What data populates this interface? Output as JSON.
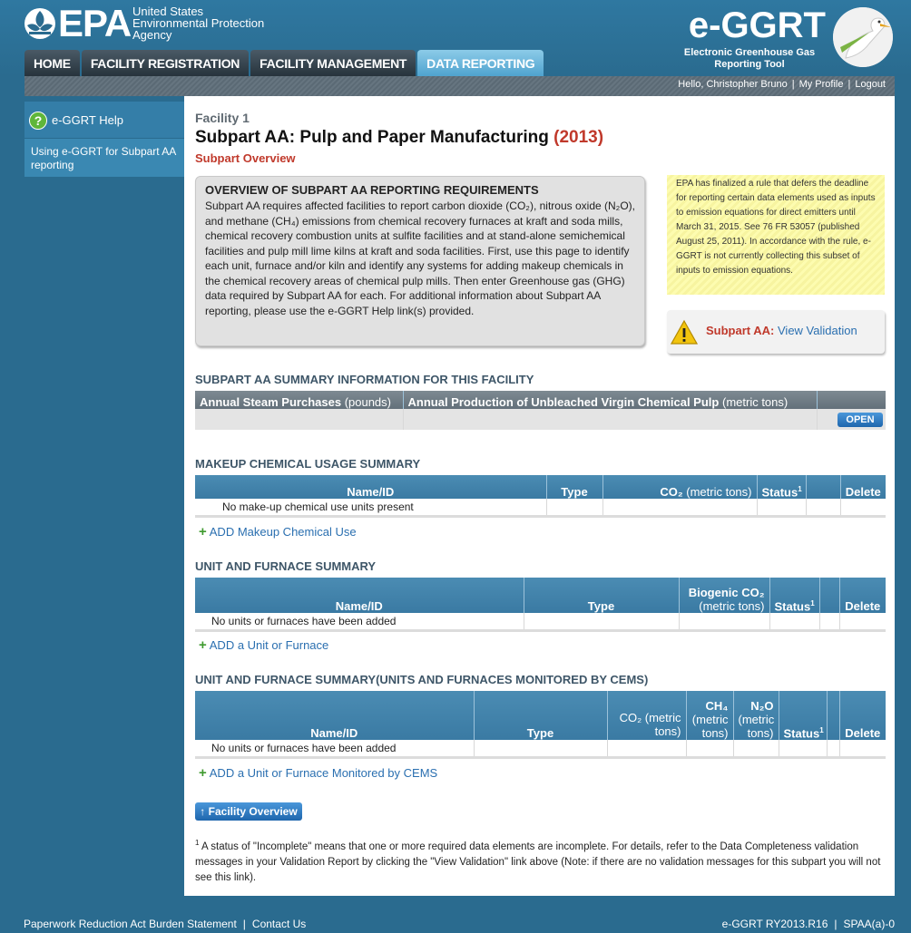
{
  "header": {
    "epa_word": "EPA",
    "agency": [
      "United States",
      "Environmental Protection",
      "Agency"
    ],
    "app_title": "e-GGRT",
    "app_subtitle": [
      "Electronic Greenhouse Gas",
      "Reporting Tool"
    ]
  },
  "nav": {
    "tabs": [
      {
        "label": "HOME"
      },
      {
        "label": "FACILITY REGISTRATION"
      },
      {
        "label": "FACILITY MANAGEMENT"
      },
      {
        "label": "DATA REPORTING",
        "active": true
      }
    ]
  },
  "userbar": {
    "greeting": "Hello, Christopher Bruno",
    "profile": "My Profile",
    "logout": "Logout"
  },
  "sidebar": {
    "help_label": "e-GGRT Help",
    "help_item": "Using e-GGRT for Subpart AA reporting"
  },
  "page": {
    "facility": "Facility 1",
    "title": "Subpart AA: Pulp and Paper Manufacturing",
    "year": "(2013)",
    "subtitle": "Subpart Overview"
  },
  "overview": {
    "heading": "OVERVIEW OF SUBPART AA REPORTING REQUIREMENTS",
    "text": "Subpart AA requires affected facilities to report carbon dioxide (CO₂), nitrous oxide (N₂O), and methane (CH₄) emissions from chemical recovery furnaces at kraft and soda mills, chemical recovery combustion units at sulfite facilities and at stand-alone semichemical facilities and pulp mill lime kilns at kraft and soda facilities. First, use this page to identify each unit, furnace and/or kiln and identify any systems for adding makeup chemicals in the chemical recovery areas of chemical pulp mills. Then enter Greenhouse gas (GHG) data required by Subpart AA for each. For additional information about Subpart AA reporting, please use the e-GGRT Help link(s) provided."
  },
  "notice": "EPA has finalized a rule that defers the deadline for reporting certain data elements used as inputs to emission equations for direct emitters until March 31, 2015. See 76 FR 53057 (published August 25, 2011). In accordance with the rule, e-GGRT is not currently collecting this subset of inputs to emission equations.",
  "validation": {
    "label": "Subpart AA:",
    "link": "View Validation"
  },
  "summary": {
    "title": "SUBPART AA SUMMARY INFORMATION FOR THIS FACILITY",
    "col1": "Annual Steam Purchases",
    "col1_unit": "(pounds)",
    "col2": "Annual Production of Unbleached Virgin Chemical Pulp",
    "col2_unit": "(metric tons)",
    "open": "OPEN"
  },
  "makeup": {
    "title": "MAKEUP CHEMICAL USAGE SUMMARY",
    "headers": {
      "name": "Name/ID",
      "type": "Type",
      "co2": "CO₂",
      "co2_unit": "(metric tons)",
      "status": "Status",
      "delete": "Delete"
    },
    "empty": "No make-up chemical use units present",
    "add": "ADD Makeup Chemical Use"
  },
  "units": {
    "title": "UNIT AND FURNACE SUMMARY",
    "headers": {
      "name": "Name/ID",
      "type": "Type",
      "bio": "Biogenic CO₂",
      "bio_unit": "(metric tons)",
      "status": "Status",
      "delete": "Delete"
    },
    "empty": "No units or furnaces have been added",
    "add": "ADD a Unit or Furnace"
  },
  "cems": {
    "title": "UNIT AND FURNACE SUMMARY(UNITS AND FURNACES MONITORED BY CEMS)",
    "headers": {
      "name": "Name/ID",
      "type": "Type",
      "co2": "CO₂ (metric tons)",
      "ch4": "CH₄",
      "ch4_unit": "(metric tons)",
      "n2o": "N₂O",
      "n2o_unit": "(metric tons)",
      "status": "Status",
      "delete": "Delete"
    },
    "empty": "No units or furnaces have been added",
    "add": "ADD a Unit or Furnace Monitored by CEMS"
  },
  "footnote_mark": "1",
  "status_mark": "1",
  "facility_overview_btn": "Facility Overview",
  "footnote": "A status of \"Incomplete\" means that one or more required data elements are incomplete. For details, refer to the Data Completeness validation messages in your Validation Report by clicking the \"View Validation\" link above (Note: if there are no validation messages for this subpart you will not see this link).",
  "footer": {
    "paperwork": "Paperwork Reduction Act Burden Statement",
    "contact": "Contact Us",
    "version": "e-GGRT RY2013.R16",
    "page_code": "SPAA(a)-0"
  }
}
